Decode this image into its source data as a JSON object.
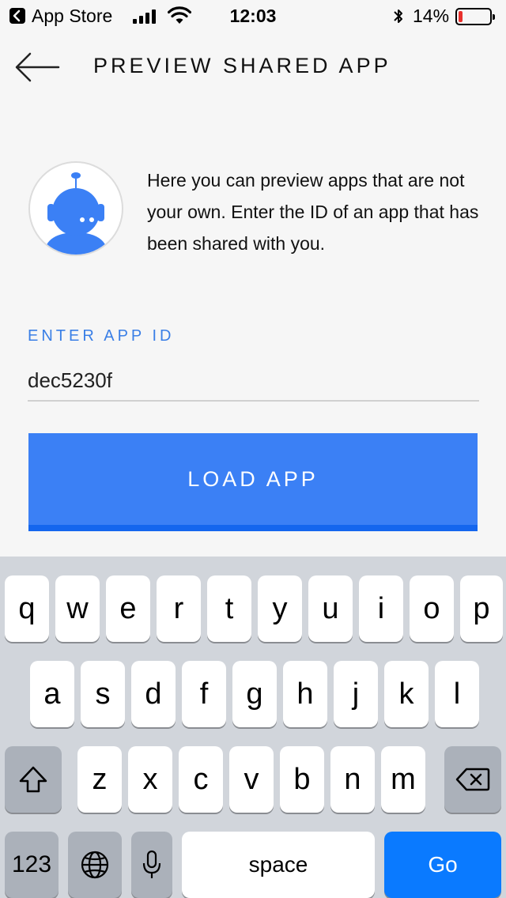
{
  "status_bar": {
    "carrier": "App Store",
    "time": "12:03",
    "battery_percent": "14%",
    "battery_level": 0.14,
    "colors": {
      "battery_low": "#e8302c"
    }
  },
  "header": {
    "title": "PREVIEW SHARED APP",
    "back_icon": "arrow-left-icon"
  },
  "intro": {
    "avatar_icon": "robot-avatar-icon",
    "text": "Here you can preview apps that are not your own. Enter the ID of an app that has been shared with you."
  },
  "form": {
    "label": "ENTER APP ID",
    "app_id_value": "dec5230f"
  },
  "load_button": {
    "label": "LOAD APP"
  },
  "keyboard": {
    "row1": [
      "q",
      "w",
      "e",
      "r",
      "t",
      "y",
      "u",
      "i",
      "o",
      "p"
    ],
    "row2": [
      "a",
      "s",
      "d",
      "f",
      "g",
      "h",
      "j",
      "k",
      "l"
    ],
    "row3": [
      "z",
      "x",
      "c",
      "v",
      "b",
      "n",
      "m"
    ],
    "numbers_label": "123",
    "space_label": "space",
    "go_label": "Go",
    "icons": [
      "shift-icon",
      "backspace-icon",
      "globe-icon",
      "microphone-icon"
    ]
  },
  "colors": {
    "accent": "#3b80f5",
    "label_blue": "#3a7fe6",
    "go_key": "#0a7aff"
  }
}
